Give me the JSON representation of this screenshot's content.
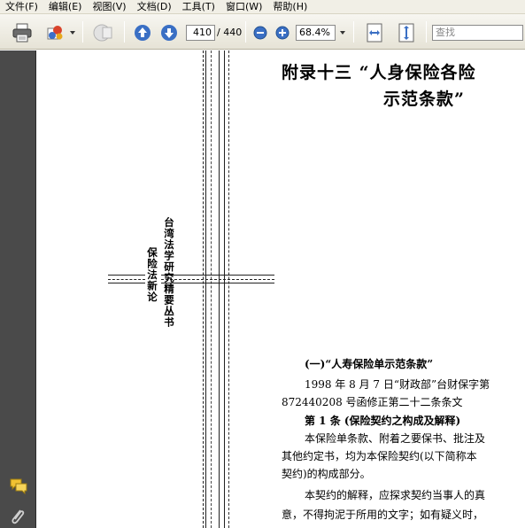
{
  "menu": {
    "items": [
      "文件(F)",
      "编辑(E)",
      "视图(V)",
      "文档(D)",
      "工具(T)",
      "窗口(W)",
      "帮助(H)"
    ]
  },
  "toolbar": {
    "page_current": "410",
    "page_total": "/ 440",
    "zoom_value": "68.4%",
    "search_placeholder": "查找",
    "icons": [
      "print-icon",
      "share-icon",
      "shape-icon",
      "page-up-icon",
      "page-down-icon",
      "zoom-out-icon",
      "zoom-in-icon",
      "fit-width-icon",
      "fit-page-icon"
    ]
  },
  "nav": {
    "icons": [
      "comments-icon",
      "attachment-icon"
    ]
  },
  "document": {
    "title_line1": "附录十三 “人身保险各险",
    "title_line2": "示范条款”",
    "spine_series": "台湾法学研究精要丛书",
    "spine_book": "保险法新论",
    "section_heading": "(一)“人寿保险单示范条款”",
    "lines": [
      "1998 年 8 月 7 日“财政部”台财保字第",
      "872440208 号函修正第二十二条条文",
      "第 1 条 (保险契约之构成及解释)",
      "本保险单条款、附着之要保书、批注及",
      "其他约定书，均为本保险契约(以下简称本",
      "契约)的构成部分。",
      "本契约的解释，应探求契约当事人的真",
      "意，不得拘泥于所用的文字；如有疑义时，"
    ]
  },
  "colors": {
    "menubar_bg": "#f1efe6",
    "nav_bg": "#4a4a4a",
    "icon_blue": "#3a6fc4"
  }
}
